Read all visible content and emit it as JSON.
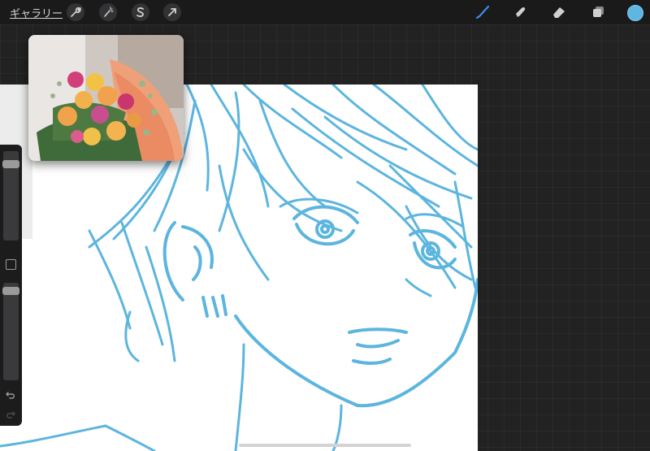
{
  "topbar": {
    "gallery_label": "ギャラリー",
    "left_tools": [
      {
        "name": "actions",
        "icon": "wrench-icon"
      },
      {
        "name": "adjustments",
        "icon": "magic-wand-icon"
      },
      {
        "name": "selection",
        "icon": "selection-s-icon"
      },
      {
        "name": "transform",
        "icon": "arrow-cursor-icon"
      }
    ],
    "right_tools": [
      {
        "name": "brush",
        "icon": "brush-icon",
        "active": true
      },
      {
        "name": "smudge",
        "icon": "smudge-icon"
      },
      {
        "name": "eraser",
        "icon": "eraser-icon"
      },
      {
        "name": "layers",
        "icon": "layers-icon"
      }
    ],
    "current_color": "#5eb7e3"
  },
  "colors": {
    "stroke": "#5cb5df",
    "active_tool": "#3a8ee8",
    "toolbar_bg": "#1a1a1b"
  },
  "side_toolbar": {
    "brush_size_level": 0.9,
    "opacity_level": 0.9
  },
  "reference_window": {
    "subject": "flower-bouquet"
  }
}
